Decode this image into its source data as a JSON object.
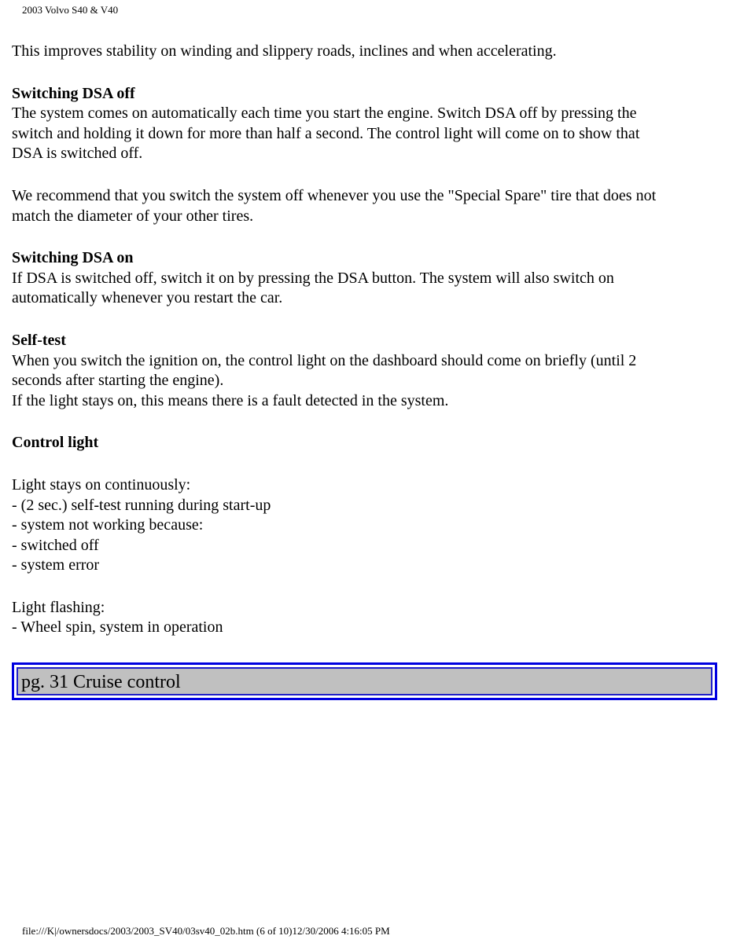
{
  "header": {
    "title": "2003 Volvo S40 & V40"
  },
  "content": {
    "intro": "This improves stability on winding and slippery roads, inclines and when accelerating.",
    "sections": [
      {
        "heading": "Switching DSA off",
        "lines": [
          "The system comes on automatically each time you start the engine. Switch DSA off by pressing the",
          "switch and holding it down for more than half a second. The control light will come on to show that",
          "DSA is switched off."
        ]
      },
      {
        "heading": "",
        "lines": [
          "We recommend that you switch the system off whenever you use the \"Special Spare\" tire that does not",
          "match the diameter of your other tires."
        ]
      },
      {
        "heading": "Switching DSA on",
        "lines": [
          "If DSA is switched off, switch it on by pressing the DSA button. The system will also switch on",
          "automatically whenever you restart the car."
        ]
      },
      {
        "heading": "Self-test",
        "lines": [
          "When you switch the ignition on, the control light on the dashboard should come on briefly (until 2",
          "seconds after starting the engine).",
          "If the light stays on, this means there is a fault detected in the system."
        ]
      }
    ],
    "control_light": {
      "heading": "Control light",
      "continuous": {
        "label": "Light stays on continuously:",
        "items": [
          "- (2 sec.) self-test running during start-up",
          "- system not working because:",
          "- switched off",
          "- system error"
        ]
      },
      "flashing": {
        "label": "Light flashing:",
        "items": [
          "- Wheel spin, system in operation"
        ]
      }
    }
  },
  "nav": {
    "link_label": "pg. 31 Cruise control",
    "border_color": "#0000e0",
    "fill_color": "#c0c0c0"
  },
  "footer": {
    "text": "file:///K|/ownersdocs/2003/2003_SV40/03sv40_02b.htm (6 of 10)12/30/2006 4:16:05 PM"
  }
}
